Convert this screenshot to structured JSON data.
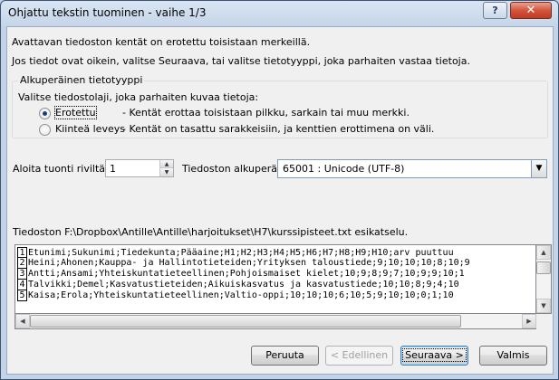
{
  "window": {
    "title": "Ohjattu tekstin tuominen - vaihe 1/3",
    "help_label": "?",
    "close_label": "✕"
  },
  "intro": {
    "line1": "Avattavan tiedoston kentät on erotettu toisistaan merkeillä.",
    "line2": "Jos tiedot ovat oikein, valitse Seuraava, tai valitse tietotyyppi, joka parhaiten vastaa tietoja."
  },
  "original_type": {
    "group_title": "Alkuperäinen tietotyyppi",
    "prompt": "Valitse tiedostolaji, joka parhaiten kuvaa tietoja:",
    "options": [
      {
        "label": "Erotettu",
        "description": "- Kentät erottaa toisistaan pilkku, sarkain tai muu merkki.",
        "selected": true
      },
      {
        "label": "Kiinteä leveys",
        "description": "- Kentät on tasattu sarakkeisiin, ja kenttien erottimena on väli.",
        "selected": false
      }
    ]
  },
  "start_row": {
    "label": "Aloita tuonti riviltä:",
    "value": "1"
  },
  "file_origin": {
    "label": "Tiedoston alkuperä:",
    "value": "65001 : Unicode (UTF-8)"
  },
  "preview": {
    "caption": "Tiedoston F:\\Dropbox\\Antille\\Antille\\harjoitukset\\H7\\kurssipisteet.txt esikatselu.",
    "lines": [
      {
        "no": "1",
        "text": "Etunimi;Sukunimi;Tiedekunta;Pääaine;H1;H2;H3;H4;H5;H6;H7;H8;H9;H10;arv puuttuu"
      },
      {
        "no": "2",
        "text": "Heini;Ahonen;Kauppa- ja Hallintotieteiden;Yrityksen taloustiede;9;10;10;10;8;10;9"
      },
      {
        "no": "3",
        "text": "Antti;Ansami;Yhteiskuntatieteellinen;Pohjoismaiset kielet;10;9;8;9;7;10;9;9;10;1"
      },
      {
        "no": "4",
        "text": "Talvikki;Demel;Kasvatustieteiden;Aikuiskasvatus ja kasvatustiede;10;10;8;9;4;10"
      },
      {
        "no": "5",
        "text": "Kaisa;Erola;Yhteiskuntatieteellinen;Valtio-oppi;10;10;10;6;10;5;9;10;10;0;1;10"
      }
    ]
  },
  "buttons": {
    "cancel": "Peruuta",
    "back": "< Edellinen",
    "next": "Seuraava >",
    "finish": "Valmis"
  }
}
